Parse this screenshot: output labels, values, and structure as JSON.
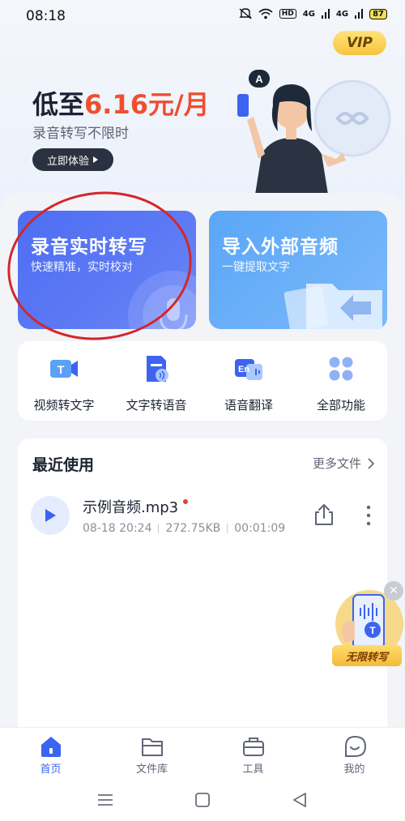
{
  "status_bar": {
    "time": "08:18",
    "hd": "HD",
    "signal1": "4G",
    "signal2": "4G",
    "battery": "87"
  },
  "vip_badge": "VIP",
  "promo": {
    "title_prefix": "低至",
    "title_price": "6.16元/月",
    "subtitle": "录音转写不限时",
    "cta_label": "立即体验",
    "bubble_letter": "A"
  },
  "feature_cards": [
    {
      "title": "录音实时转写",
      "subtitle": "快速精准，实时校对"
    },
    {
      "title": "导入外部音频",
      "subtitle": "一键提取文字"
    }
  ],
  "tools": [
    {
      "label": "视频转文字",
      "icon": "video-to-text-icon",
      "glyph": "T"
    },
    {
      "label": "文字转语音",
      "icon": "text-to-speech-icon"
    },
    {
      "label": "语音翻译",
      "icon": "voice-translate-icon",
      "glyph": "En"
    },
    {
      "label": "全部功能",
      "icon": "all-features-icon"
    }
  ],
  "recent": {
    "title": "最近使用",
    "more_label": "更多文件",
    "files": [
      {
        "name": "示例音频.mp3",
        "date": "08-18 20:24",
        "size": "272.75KB",
        "duration": "00:01:09"
      }
    ]
  },
  "float_promo": {
    "label": "无限转写",
    "glyph": "T"
  },
  "bottom_nav": [
    {
      "label": "首页",
      "icon": "home-icon",
      "active": true
    },
    {
      "label": "文件库",
      "icon": "folder-icon",
      "active": false
    },
    {
      "label": "工具",
      "icon": "toolbox-icon",
      "active": false
    },
    {
      "label": "我的",
      "icon": "profile-icon",
      "active": false
    }
  ],
  "colors": {
    "accent": "#3d64f0",
    "price": "#ee4f2f",
    "record_card": "#4e6ef2",
    "import_card": "#5aa6f7",
    "vip_gold": "#f6c53f",
    "annotation_circle": "#d4262b"
  }
}
